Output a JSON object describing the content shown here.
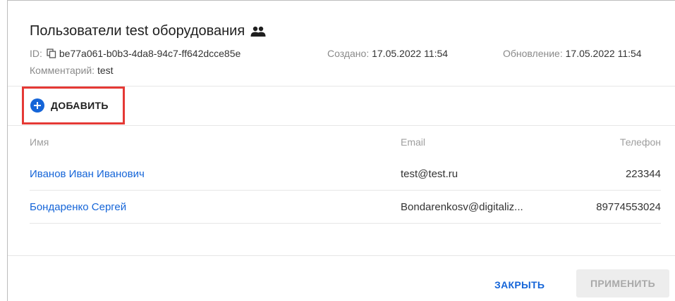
{
  "dialog": {
    "title": "Пользователи test оборудования",
    "id_label": "ID:",
    "id_value": "be77a061-b0b3-4da8-94c7-ff642dcce85e",
    "created_label": "Создано:",
    "created_value": "17.05.2022 11:54",
    "updated_label": "Обновление:",
    "updated_value": "17.05.2022 11:54",
    "comment_label": "Комментарий:",
    "comment_value": "test"
  },
  "toolbar": {
    "add_label": "ДОБАВИТЬ"
  },
  "table": {
    "columns": [
      "Имя",
      "Email",
      "Телефон"
    ],
    "rows": [
      {
        "name": "Иванов Иван Иванович",
        "email": "test@test.ru",
        "phone": "223344"
      },
      {
        "name": "Бондаренко Сергей",
        "email": "Bondarenkosv@digitaliz...",
        "phone": "89774553024"
      }
    ]
  },
  "footer": {
    "close_label": "ЗАКРЫТЬ",
    "apply_label": "ПРИМЕНИТЬ"
  },
  "colors": {
    "accent": "#1565d8",
    "highlight": "#e53935"
  },
  "icons": [
    "group-icon",
    "copy-icon",
    "plus-circle-icon"
  ]
}
